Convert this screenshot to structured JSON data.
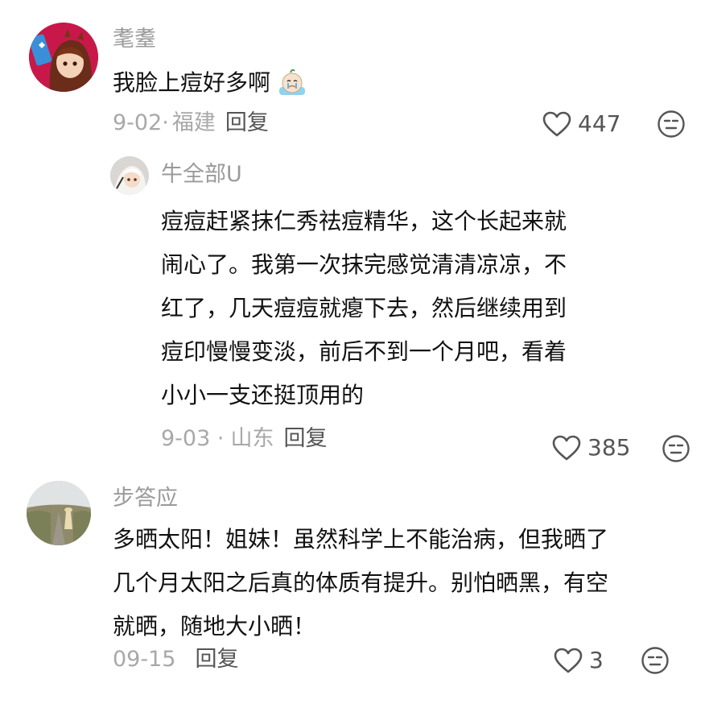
{
  "comments": [
    {
      "username": "耄耋",
      "text": "我脸上痘好多啊",
      "emoji": "crying-face-emoji",
      "date": "9-02·",
      "location": "福建",
      "reply_label": "回复",
      "likes": "447",
      "reply": {
        "username": "牛全部U",
        "lines": [
          "痘痘赶紧抹仁秀祛痘精华，这个长起来就",
          "闹心了。我第一次抹完感觉清清凉凉，不",
          "红了，几天痘痘就瘪下去，然后继续用到",
          "痘印慢慢变淡，前后不到一个月吧，看着",
          "小小一支还挺顶用的"
        ],
        "date": "9-03 ·",
        "location": "山东",
        "reply_label": "回复",
        "likes": "385"
      }
    },
    {
      "username": "步答应",
      "lines": [
        "多晒太阳！姐妹！虽然科学上不能治病，但我晒了",
        "几个月太阳之后真的体质有提升。别怕晒黑，有空",
        "就晒，随地大小晒！"
      ],
      "date": "09-15",
      "reply_label": "回复",
      "likes": "3"
    }
  ],
  "icons": {
    "like": "heart-outline-icon",
    "react": "neutral-face-icon"
  },
  "colors": {
    "username": "#9a9a9a",
    "meta": "#a8a8a8",
    "text": "#111111"
  }
}
